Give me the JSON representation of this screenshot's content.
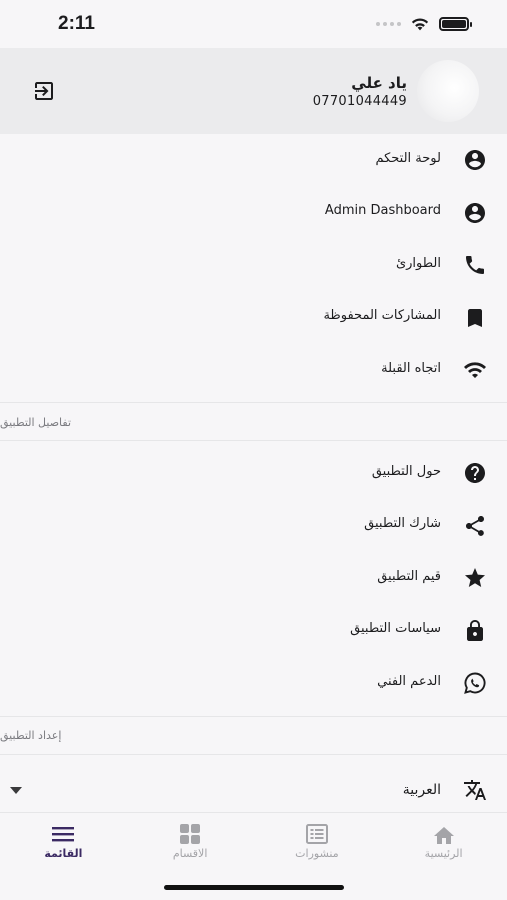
{
  "status_bar": {
    "time": "2:11"
  },
  "profile": {
    "name": "ياد علي",
    "phone": "07701044449"
  },
  "menu": [
    {
      "label": "لوحة التحكم",
      "icon": "account-circle-icon"
    },
    {
      "label": "Admin Dashboard",
      "icon": "account-circle-icon"
    },
    {
      "label": "الطوارئ",
      "icon": "phone-icon"
    },
    {
      "label": "المشاركات المحفوظة",
      "icon": "bookmark-icon"
    },
    {
      "label": "اتجاه القبلة",
      "icon": "wifi-icon"
    }
  ],
  "sections": {
    "app_details": "تفاصيل التطبيق",
    "app_settings": "إعداد التطبيق"
  },
  "details_menu": [
    {
      "label": "حول التطبيق",
      "icon": "help-circle-icon"
    },
    {
      "label": "شارك التطبيق",
      "icon": "share-icon"
    },
    {
      "label": "قيم التطبيق",
      "icon": "star-icon"
    },
    {
      "label": "سياسات التطبيق",
      "icon": "lock-icon"
    },
    {
      "label": "الدعم الفني",
      "icon": "whatsapp-icon"
    }
  ],
  "language": {
    "label": "العربية",
    "icon": "translate-icon"
  },
  "bottom_nav": [
    {
      "label": "الرئيسية",
      "icon": "home-icon",
      "active": false
    },
    {
      "label": "منشورات",
      "icon": "list-alt-icon",
      "active": false
    },
    {
      "label": "الاقسام",
      "icon": "grid-icon",
      "active": false
    },
    {
      "label": "القائمة",
      "icon": "menu-icon",
      "active": true
    }
  ],
  "colors": {
    "accent": "#3b2a63",
    "inactive": "#a4a4a8",
    "header_bg": "#ebebed",
    "page_bg": "#f7f6f8"
  }
}
